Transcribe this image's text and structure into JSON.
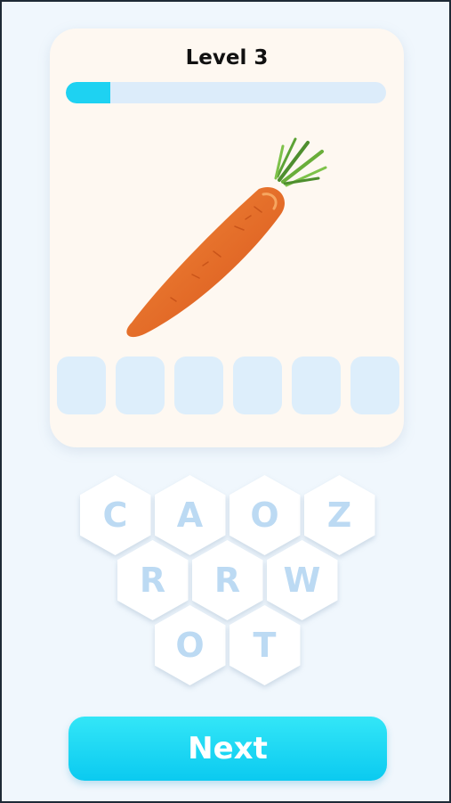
{
  "level": {
    "title": "Level 3",
    "progress_fraction": 0.14
  },
  "puzzle": {
    "image_icon": "carrot",
    "answer_slots": [
      "",
      "",
      "",
      "",
      "",
      ""
    ]
  },
  "letters": [
    "C",
    "A",
    "O",
    "Z",
    "R",
    "R",
    "W",
    "O",
    "T"
  ],
  "next_button": {
    "label": "Next"
  },
  "colors": {
    "background": "#f0f7fd",
    "card": "#fef8f1",
    "accent": "#1ed2f2",
    "slot": "#ddeefb",
    "letter": "#bcdaf3",
    "progress_track": "#dcecfa"
  }
}
